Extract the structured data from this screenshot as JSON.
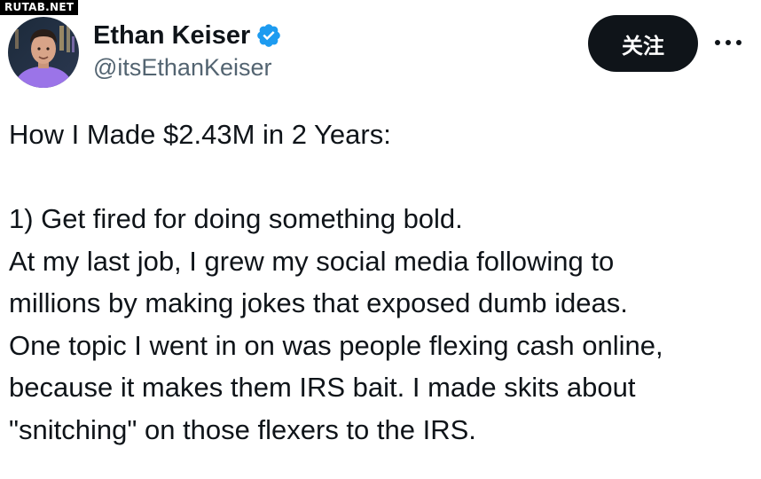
{
  "watermark": "RUTAB.NET",
  "author": {
    "display_name": "Ethan Keiser",
    "handle": "@itsEthanKeiser",
    "verified_icon": "verified-badge-icon",
    "verified_color": "#1d9bf0"
  },
  "actions": {
    "follow_label": "关注",
    "more_icon": "more-horizontal-icon"
  },
  "tweet": {
    "lines": [
      "How I Made $2.43M in 2 Years:",
      "",
      "1) Get fired for doing something bold.",
      "At my last job, I grew my social media following to",
      "millions by making jokes that exposed dumb ideas.",
      "One topic I went in on was people flexing cash online,",
      "because it makes them IRS bait. I made skits about",
      "\"snitching\" on those flexers to the IRS."
    ]
  },
  "colors": {
    "text_primary": "#0f1419",
    "text_secondary": "#536471",
    "button_bg": "#0f1419",
    "button_text": "#ffffff"
  }
}
